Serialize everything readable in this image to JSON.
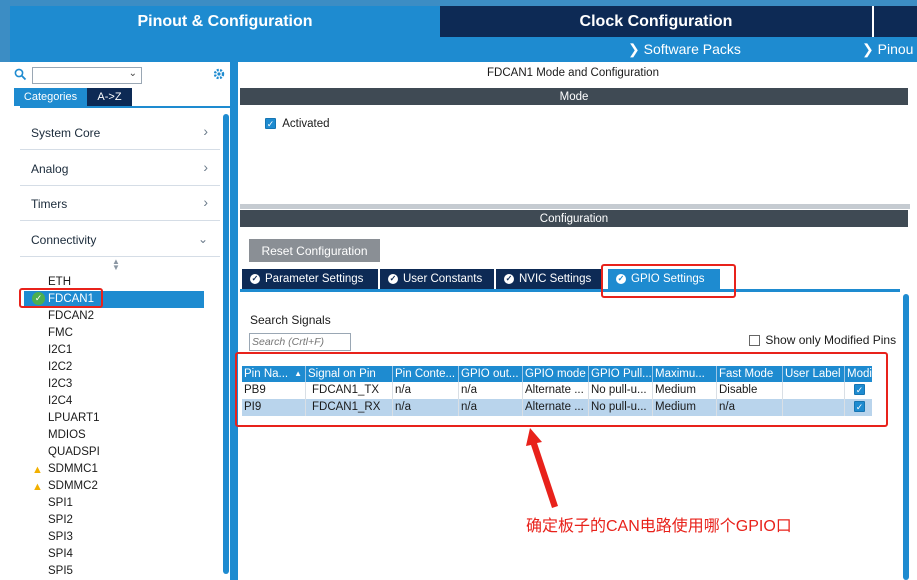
{
  "top_tabs": {
    "pinout": "Pinout & Configuration",
    "clock": "Clock Configuration"
  },
  "sub_menu": {
    "software_packs": "Software Packs",
    "pinout": "Pinou"
  },
  "left": {
    "tab_categories": "Categories",
    "tab_az": "A->Z",
    "categories": [
      "System Core",
      "Analog",
      "Timers",
      "Connectivity"
    ],
    "peripherals": [
      "ETH",
      "FDCAN1",
      "FDCAN2",
      "FMC",
      "I2C1",
      "I2C2",
      "I2C3",
      "I2C4",
      "LPUART1",
      "MDIOS",
      "QUADSPI",
      "SDMMC1",
      "SDMMC2",
      "SPI1",
      "SPI2",
      "SPI3",
      "SPI4",
      "SPI5"
    ],
    "selected": "FDCAN1"
  },
  "right": {
    "title": "FDCAN1 Mode and Configuration",
    "mode_header": "Mode",
    "activated_label": "Activated",
    "config_header": "Configuration",
    "reset_button": "Reset Configuration",
    "tabs": [
      "Parameter Settings",
      "User Constants",
      "NVIC Settings",
      "GPIO Settings"
    ],
    "active_tab": "GPIO Settings",
    "search_label": "Search Signals",
    "search_placeholder": "Search (Crtl+F)",
    "show_modified_label": "Show only Modified Pins",
    "columns": [
      "Pin Na...",
      "Signal on Pin",
      "Pin Conte...",
      "GPIO out...",
      "GPIO mode",
      "GPIO Pull...",
      "Maximu...",
      "Fast Mode",
      "User Label",
      "Modified"
    ],
    "rows": [
      {
        "pin": "PB9",
        "signal": "FDCAN1_TX",
        "context": "n/a",
        "output": "n/a",
        "mode": "Alternate ...",
        "pull": "No pull-u...",
        "speed": "Medium",
        "fast": "Disable",
        "label": "",
        "modified": true
      },
      {
        "pin": "PI9",
        "signal": "FDCAN1_RX",
        "context": "n/a",
        "output": "n/a",
        "mode": "Alternate ...",
        "pull": "No pull-u...",
        "speed": "Medium",
        "fast": "n/a",
        "label": "",
        "modified": true
      }
    ]
  },
  "annotation": "确定板子的CAN电路使用哪个GPIO口",
  "colors": {
    "accent": "#1e8bd0",
    "dark_navy": "#0d2a55",
    "header_bar": "#3f4a54",
    "annotation_red": "#e8221b"
  }
}
